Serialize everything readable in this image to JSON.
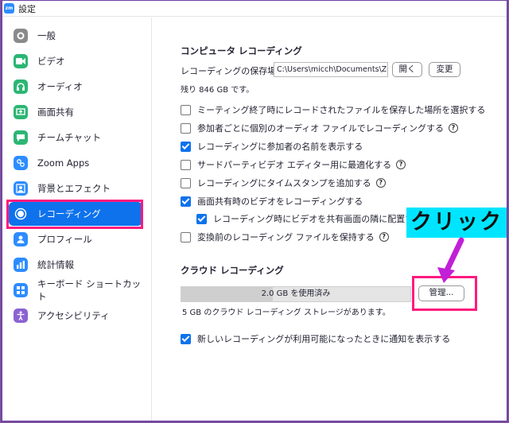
{
  "window": {
    "app_icon": "zm",
    "title": "設定"
  },
  "sidebar": {
    "items": [
      {
        "label": "一般",
        "icon": "gear-icon",
        "color": "#8a8a8a"
      },
      {
        "label": "ビデオ",
        "icon": "video-icon",
        "color": "#2bb673"
      },
      {
        "label": "オーディオ",
        "icon": "headphones-icon",
        "color": "#2bb673"
      },
      {
        "label": "画面共有",
        "icon": "screen-share-icon",
        "color": "#2bb673"
      },
      {
        "label": "チームチャット",
        "icon": "chat-icon",
        "color": "#2bb673"
      },
      {
        "label": "Zoom Apps",
        "icon": "apps-icon",
        "color": "#2d8cff"
      },
      {
        "label": "背景とエフェクト",
        "icon": "background-icon",
        "color": "#2d8cff"
      },
      {
        "label": "レコーディング",
        "icon": "record-icon",
        "color": "#ffffff",
        "active": true
      },
      {
        "label": "プロフィール",
        "icon": "profile-icon",
        "color": "#2d8cff"
      },
      {
        "label": "統計情報",
        "icon": "stats-icon",
        "color": "#2d8cff"
      },
      {
        "label": "キーボード ショートカット",
        "icon": "keyboard-icon",
        "color": "#2d8cff"
      },
      {
        "label": "アクセシビリティ",
        "icon": "accessibility-icon",
        "color": "#8a63d2"
      }
    ]
  },
  "local_recording": {
    "title": "コンピュータ レコーディング",
    "location_label": "レコーディングの保存場所:",
    "location_value": "C:\\Users\\micch\\Documents\\Zoom",
    "open_button": "開く",
    "change_button": "変更",
    "remaining": "残り 846 GB です。",
    "options": [
      {
        "label": "ミーティング終了時にレコードされたファイルを保存した場所を選択する",
        "checked": false,
        "help": false
      },
      {
        "label": "参加者ごとに個別のオーディオ ファイルでレコーディングする",
        "checked": false,
        "help": true
      },
      {
        "label": "レコーディングに参加者の名前を表示する",
        "checked": true,
        "help": false
      },
      {
        "label": "サードパーティビデオ エディター用に最適化する",
        "checked": false,
        "help": true
      },
      {
        "label": "レコーディングにタイムスタンプを追加する",
        "checked": false,
        "help": true
      },
      {
        "label": "画面共有時のビデオをレコーディングする",
        "checked": true,
        "help": false
      },
      {
        "label": "レコーディング時にビデオを共有画面の隣に配置する",
        "checked": true,
        "help": false
      },
      {
        "label": "変換前のレコーディング ファイルを保持する",
        "checked": false,
        "help": true
      }
    ]
  },
  "cloud_recording": {
    "title": "クラウド レコーディング",
    "usage": "2.0 GB を使用済み",
    "usage_fraction": 0.4,
    "manage_button": "管理...",
    "storage_note": "5 GB のクラウド レコーディング ストレージがあります。",
    "notify_label": "新しいレコーディングが利用可能になったときに通知を表示する",
    "notify_checked": true
  },
  "annotation": {
    "text": "クリック",
    "highlight_color": "#ff1a7f",
    "label_bg": "#00e5ff"
  },
  "help_glyph": "?"
}
